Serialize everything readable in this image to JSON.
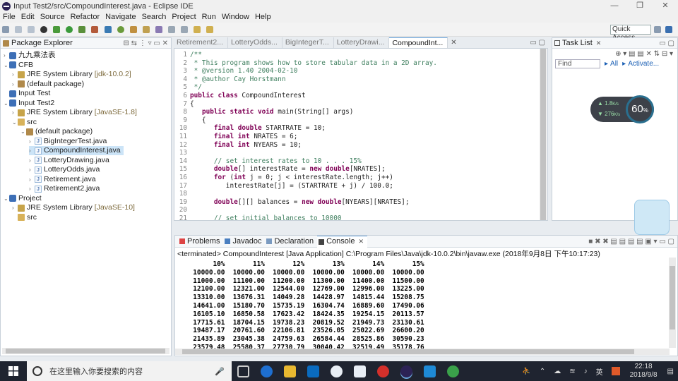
{
  "window": {
    "title": "Input Test2/src/CompoundInterest.java - Eclipse IDE",
    "buttons": [
      "—",
      "❐",
      "✕"
    ]
  },
  "menu": [
    "File",
    "Edit",
    "Source",
    "Refactor",
    "Navigate",
    "Search",
    "Project",
    "Run",
    "Window",
    "Help"
  ],
  "toolbar": {
    "quick_access": "Quick Access"
  },
  "package_explorer": {
    "title": "Package Explorer",
    "rows": [
      {
        "label": "九九乘法表",
        "indent": 0,
        "arrow": "›",
        "icon": "project"
      },
      {
        "label": "CFB",
        "indent": 0,
        "arrow": "⌄",
        "icon": "project"
      },
      {
        "label": "JRE System Library",
        "suffix": "[jdk-10.0.2]",
        "indent": 1,
        "arrow": "›",
        "icon": "lib"
      },
      {
        "label": "(default package)",
        "indent": 1,
        "arrow": "›",
        "icon": "pkg"
      },
      {
        "label": "Input Test",
        "indent": 0,
        "arrow": "",
        "icon": "project"
      },
      {
        "label": "Input Test2",
        "indent": 0,
        "arrow": "⌄",
        "icon": "project"
      },
      {
        "label": "JRE System Library",
        "suffix": "[JavaSE-1.8]",
        "indent": 1,
        "arrow": "›",
        "icon": "lib"
      },
      {
        "label": "src",
        "indent": 1,
        "arrow": "⌄",
        "icon": "src"
      },
      {
        "label": "(default package)",
        "indent": 2,
        "arrow": "⌄",
        "icon": "pkg"
      },
      {
        "label": "BigIntegerTest.java",
        "indent": 3,
        "arrow": "›",
        "icon": "java"
      },
      {
        "label": "CompoundInterest.java",
        "indent": 3,
        "arrow": "›",
        "icon": "java",
        "selected": true
      },
      {
        "label": "LotteryDrawing.java",
        "indent": 3,
        "arrow": "›",
        "icon": "java"
      },
      {
        "label": "LotteryOdds.java",
        "indent": 3,
        "arrow": "›",
        "icon": "java"
      },
      {
        "label": "Retirement.java",
        "indent": 3,
        "arrow": "›",
        "icon": "java"
      },
      {
        "label": "Retirement2.java",
        "indent": 3,
        "arrow": "›",
        "icon": "java"
      },
      {
        "label": "Project",
        "indent": 0,
        "arrow": "⌄",
        "icon": "project"
      },
      {
        "label": "JRE System Library",
        "suffix": "[JavaSE-10]",
        "indent": 1,
        "arrow": "›",
        "icon": "lib"
      },
      {
        "label": "src",
        "indent": 1,
        "arrow": "",
        "icon": "src"
      }
    ]
  },
  "editor": {
    "tabs": [
      "Retirement2...",
      "LotteryOdds...",
      "BigIntegerT...",
      "LotteryDrawi...",
      "CompoundInt..."
    ],
    "active_tab": 4,
    "lines": [
      {
        "n": "1",
        "parts": [
          [
            "c",
            "/**"
          ]
        ]
      },
      {
        "n": "2",
        "parts": [
          [
            "c",
            " * This program shows how to store tabular data in a 2D array."
          ]
        ]
      },
      {
        "n": "3",
        "parts": [
          [
            "c",
            " * @version 1.40 2004-02-10"
          ]
        ]
      },
      {
        "n": "4",
        "parts": [
          [
            "c",
            " * @author Cay Horstmann"
          ]
        ]
      },
      {
        "n": "5",
        "parts": [
          [
            "c",
            " */"
          ]
        ]
      },
      {
        "n": "6",
        "parts": [
          [
            "k",
            "public class"
          ],
          [
            "t",
            " CompoundInterest"
          ]
        ]
      },
      {
        "n": "7",
        "parts": [
          [
            "t",
            "{"
          ]
        ]
      },
      {
        "n": "8",
        "parts": [
          [
            "t",
            "   "
          ],
          [
            "k",
            "public static void"
          ],
          [
            "t",
            " main(String[] args)"
          ]
        ]
      },
      {
        "n": "9",
        "parts": [
          [
            "t",
            "   {"
          ]
        ]
      },
      {
        "n": "10",
        "parts": [
          [
            "t",
            "      "
          ],
          [
            "k",
            "final double"
          ],
          [
            "t",
            " STARTRATE = 10;"
          ]
        ]
      },
      {
        "n": "11",
        "parts": [
          [
            "t",
            "      "
          ],
          [
            "k",
            "final int"
          ],
          [
            "t",
            " NRATES = 6;"
          ]
        ]
      },
      {
        "n": "12",
        "parts": [
          [
            "t",
            "      "
          ],
          [
            "k",
            "final int"
          ],
          [
            "t",
            " NYEARS = 10;"
          ]
        ]
      },
      {
        "n": "13",
        "parts": [
          [
            "t",
            ""
          ]
        ]
      },
      {
        "n": "14",
        "parts": [
          [
            "t",
            "      "
          ],
          [
            "c",
            "// set interest rates to 10 . . . 15%"
          ]
        ]
      },
      {
        "n": "15",
        "parts": [
          [
            "t",
            "      "
          ],
          [
            "k",
            "double"
          ],
          [
            "t",
            "[] interestRate = "
          ],
          [
            "k",
            "new double"
          ],
          [
            "t",
            "[NRATES];"
          ]
        ]
      },
      {
        "n": "16",
        "parts": [
          [
            "t",
            "      "
          ],
          [
            "k",
            "for"
          ],
          [
            "t",
            " ("
          ],
          [
            "k",
            "int"
          ],
          [
            "t",
            " j = 0; j < interestRate.length; j++)"
          ]
        ]
      },
      {
        "n": "17",
        "parts": [
          [
            "t",
            "         interestRate[j] = (STARTRATE + j) / 100.0;"
          ]
        ]
      },
      {
        "n": "18",
        "parts": [
          [
            "t",
            ""
          ]
        ]
      },
      {
        "n": "19",
        "parts": [
          [
            "t",
            "      "
          ],
          [
            "k",
            "double"
          ],
          [
            "t",
            "[][] balances = "
          ],
          [
            "k",
            "new double"
          ],
          [
            "t",
            "[NYEARS][NRATES];"
          ]
        ]
      },
      {
        "n": "20",
        "parts": [
          [
            "t",
            ""
          ]
        ]
      },
      {
        "n": "21",
        "parts": [
          [
            "t",
            "      "
          ],
          [
            "c",
            "// set initial balances to 10000"
          ]
        ]
      }
    ]
  },
  "task_list": {
    "title": "Task List",
    "find_placeholder": "Find",
    "all": "All",
    "activate": "Activate..."
  },
  "net_widget": {
    "up": "1.8",
    "up_unit": "K/s",
    "down": "276",
    "down_unit": "K/s",
    "percent": "60",
    "percent_unit": "%"
  },
  "console": {
    "tabs": [
      "Problems",
      "Javadoc",
      "Declaration",
      "Console"
    ],
    "active_tab": 3,
    "status": "<terminated> CompoundInterest [Java Application] C:\\Program Files\\Java\\jdk-10.0.2\\bin\\javaw.exe (2018年9月8日 下午10:17:23)",
    "lines": [
      "       10%       11%       12%       13%       14%       15%",
      "  10000.00  10000.00  10000.00  10000.00  10000.00  10000.00",
      "  11000.00  11100.00  11200.00  11300.00  11400.00  11500.00",
      "  12100.00  12321.00  12544.00  12769.00  12996.00  13225.00",
      "  13310.00  13676.31  14049.28  14428.97  14815.44  15208.75",
      "  14641.00  15180.70  15735.19  16304.74  16889.60  17490.06",
      "  16105.10  16850.58  17623.42  18424.35  19254.15  20113.57",
      "  17715.61  18704.15  19738.23  20819.52  21949.73  23130.61",
      "  19487.17  20761.60  22106.81  23526.05  25022.69  26600.20",
      "  21435.89  23045.38  24759.63  26584.44  28525.86  30590.23",
      "  23579.48  25580.37  27730.79  30040.42  32519.49  35178.76"
    ]
  },
  "taskbar": {
    "search_placeholder": "在这里输入你要搜索的内容",
    "time": "22:18",
    "date": "2018/9/8",
    "ime": "英"
  },
  "colors": {
    "keyword": "#7f0055",
    "comment": "#3f7f5f",
    "taskbar": "#1f2430",
    "selection": "#cce4f7"
  }
}
